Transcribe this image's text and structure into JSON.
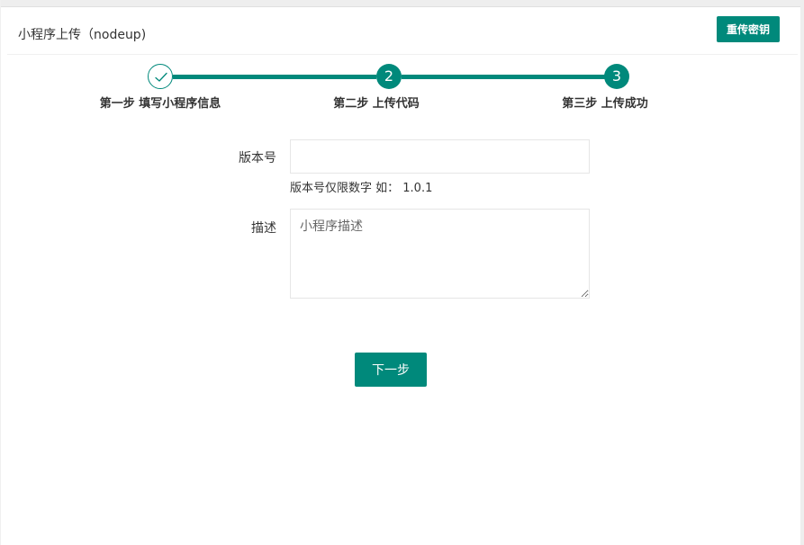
{
  "header": {
    "title": "小程序上传（nodeup)",
    "reset_button_label": "重传密钥"
  },
  "steps": [
    {
      "number": "",
      "label": "第一步 填写小程序信息",
      "state": "done",
      "icon": "check-icon"
    },
    {
      "number": "2",
      "label": "第二步 上传代码",
      "state": "active"
    },
    {
      "number": "3",
      "label": "第三步 上传成功",
      "state": "active"
    }
  ],
  "form": {
    "version": {
      "label": "版本号",
      "value": "",
      "placeholder": "",
      "hint": "版本号仅限数字 如： 1.0.1"
    },
    "description": {
      "label": "描述",
      "value": "",
      "placeholder": "小程序描述"
    },
    "next_button_label": "下一步"
  },
  "colors": {
    "accent": "#00897b",
    "border": "#e6e6e6"
  }
}
